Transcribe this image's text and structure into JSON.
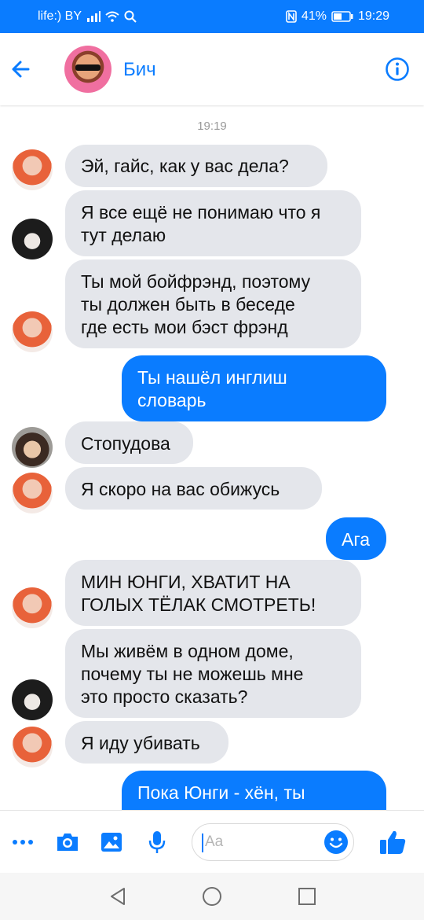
{
  "status_bar": {
    "carrier": "life:) BY",
    "battery": "41%",
    "time": "19:29"
  },
  "header": {
    "title": "Бич"
  },
  "chat": {
    "timestamp": "19:19",
    "messages": [
      {
        "direction": "in",
        "text": "Эй, гайс, как у вас дела?"
      },
      {
        "direction": "in",
        "text": "Я все ещё не понимаю что я\nтут делаю"
      },
      {
        "direction": "in",
        "text": "Ты мой бойфрэнд, поэтому\nты должен быть в беседе\nгде есть мои бэст фрэнд"
      },
      {
        "direction": "out",
        "text": "Ты нашёл инглиш\nсловарь"
      },
      {
        "direction": "in",
        "text": "Стопудова"
      },
      {
        "direction": "in",
        "text": "Я скоро на вас обижусь"
      },
      {
        "direction": "out",
        "text": "Ага"
      },
      {
        "direction": "in",
        "text": "МИН ЮНГИ, ХВАТИТ НА\nГОЛЫХ ТЁЛАК СМОТРЕТЬ!"
      },
      {
        "direction": "in",
        "text": "Мы живём в одном доме,\nпочему ты не можешь мне\nэто просто сказать?"
      },
      {
        "direction": "in",
        "text": "Я иду убивать"
      },
      {
        "direction": "out",
        "text": "Пока Юнги - хён, ты"
      }
    ]
  },
  "composer": {
    "placeholder": "Aa"
  },
  "colors": {
    "accent": "#0a7cff",
    "incoming_bubble": "#e4e6eb",
    "outgoing_bubble": "#0a7cff"
  },
  "icons": [
    "back-arrow-icon",
    "info-icon",
    "more-icon",
    "camera-icon",
    "gallery-icon",
    "microphone-icon",
    "emoji-icon",
    "like-icon",
    "nav-back-icon",
    "nav-home-icon",
    "nav-recents-icon"
  ]
}
